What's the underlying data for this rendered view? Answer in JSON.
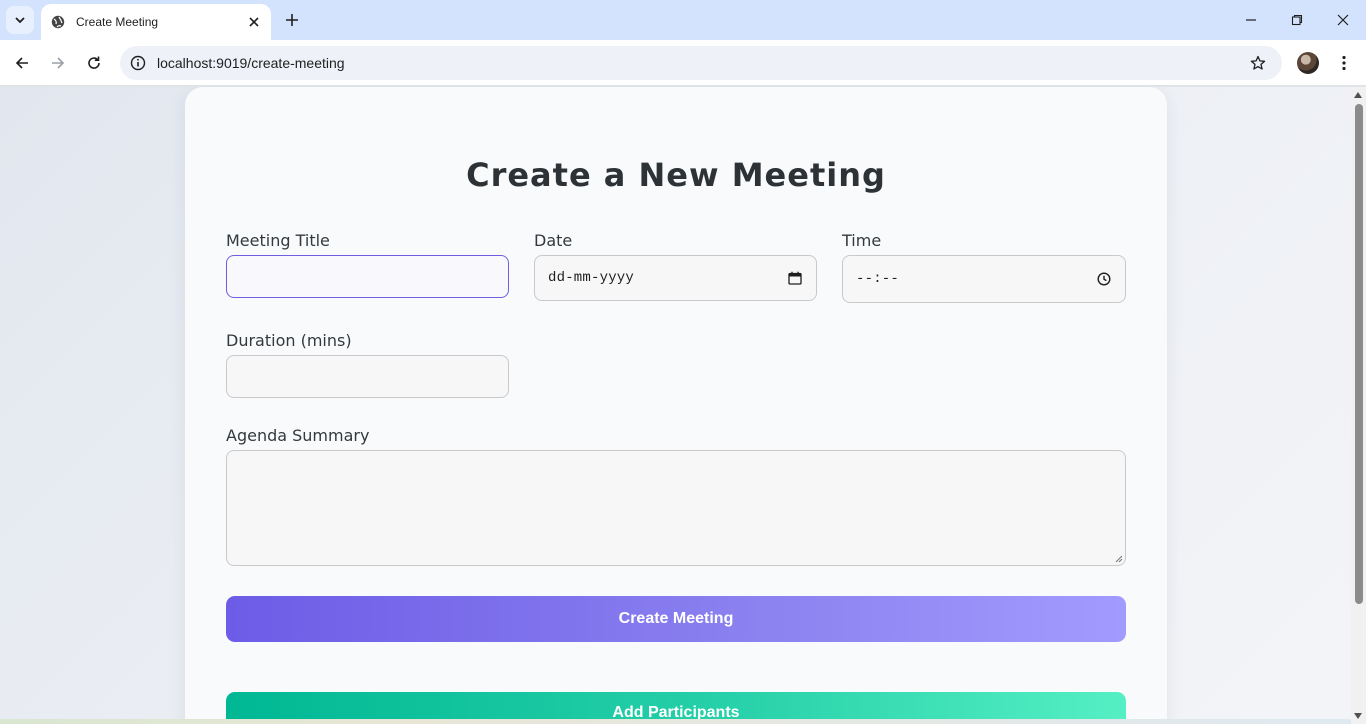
{
  "browser": {
    "tab_title": "Create Meeting",
    "url_host": "localhost",
    "url_rest": ":9019/create-meeting"
  },
  "page": {
    "title": "Create a New Meeting",
    "fields": {
      "meeting_title": {
        "label": "Meeting Title",
        "value": ""
      },
      "date": {
        "label": "Date",
        "placeholder": "dd-mm-yyyy"
      },
      "time": {
        "label": "Time",
        "placeholder": "--:--"
      },
      "duration": {
        "label": "Duration (mins)",
        "value": ""
      },
      "agenda": {
        "label": "Agenda Summary",
        "value": ""
      }
    },
    "buttons": {
      "create": "Create Meeting",
      "participants": "Add Participants"
    }
  },
  "colors": {
    "primary_gradient_start": "#6c5ce7",
    "primary_gradient_end": "#a29bfe",
    "secondary_gradient_start": "#00b894",
    "secondary_gradient_end": "#55efc4",
    "focus_border": "#6d5fe0"
  },
  "icons": {
    "tab_list": "chevron-down-icon",
    "favicon": "globe-icon",
    "tab_close": "close-icon",
    "new_tab": "plus-icon",
    "back": "arrow-left-icon",
    "forward": "arrow-right-icon",
    "reload": "reload-icon",
    "site_info": "info-icon",
    "bookmark": "star-icon",
    "menu": "more-vertical-icon",
    "calendar": "calendar-icon",
    "clock": "clock-icon"
  }
}
